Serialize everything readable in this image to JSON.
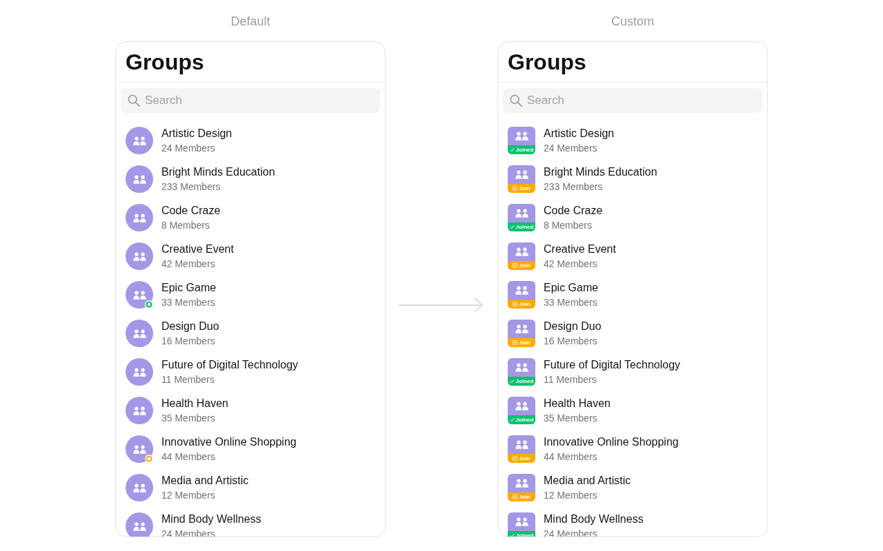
{
  "panels": [
    {
      "kind": "default",
      "caption": "Default",
      "title": "Groups",
      "search": {
        "placeholder": "Search"
      },
      "groups": [
        {
          "name": "Artistic Design",
          "members": "24 Members",
          "kind": "public"
        },
        {
          "name": "Bright Minds Education",
          "members": "233 Members",
          "kind": "public"
        },
        {
          "name": "Code Craze",
          "members": "8 Members",
          "kind": "public"
        },
        {
          "name": "Creative Event",
          "members": "42 Members",
          "kind": "public"
        },
        {
          "name": "Epic Game",
          "members": "33 Members",
          "kind": "private"
        },
        {
          "name": "Design Duo",
          "members": "16 Members",
          "kind": "public"
        },
        {
          "name": "Future of Digital Technology",
          "members": "11 Members",
          "kind": "public"
        },
        {
          "name": "Health Haven",
          "members": "35 Members",
          "kind": "public"
        },
        {
          "name": "Innovative Online Shopping",
          "members": "44 Members",
          "kind": "password"
        },
        {
          "name": "Media and Artistic",
          "members": "12 Members",
          "kind": "public"
        },
        {
          "name": "Mind Body Wellness",
          "members": "24 Members",
          "kind": "public"
        }
      ]
    },
    {
      "kind": "custom",
      "caption": "Custom",
      "title": "Groups",
      "search": {
        "placeholder": "Search"
      },
      "groups": [
        {
          "name": "Artistic Design",
          "members": "24 Members",
          "joined": true,
          "tag": "Joined"
        },
        {
          "name": "Bright Minds Education",
          "members": "233 Members",
          "joined": false,
          "tag": "Join"
        },
        {
          "name": "Code Craze",
          "members": "8 Members",
          "joined": true,
          "tag": "Joined"
        },
        {
          "name": "Creative Event",
          "members": "42 Members",
          "joined": false,
          "tag": "Join"
        },
        {
          "name": "Epic Game",
          "members": "33 Members",
          "joined": false,
          "tag": "Join"
        },
        {
          "name": "Design Duo",
          "members": "16 Members",
          "joined": false,
          "tag": "Join"
        },
        {
          "name": "Future of Digital Technology",
          "members": "11 Members",
          "joined": true,
          "tag": "Joined"
        },
        {
          "name": "Health Haven",
          "members": "35 Members",
          "joined": true,
          "tag": "Joined"
        },
        {
          "name": "Innovative Online Shopping",
          "members": "44 Members",
          "joined": false,
          "tag": "Join"
        },
        {
          "name": "Media and Artistic",
          "members": "12 Members",
          "joined": false,
          "tag": "Join"
        },
        {
          "name": "Mind Body Wellness",
          "members": "24 Members",
          "joined": true,
          "tag": "Joined"
        }
      ]
    }
  ]
}
